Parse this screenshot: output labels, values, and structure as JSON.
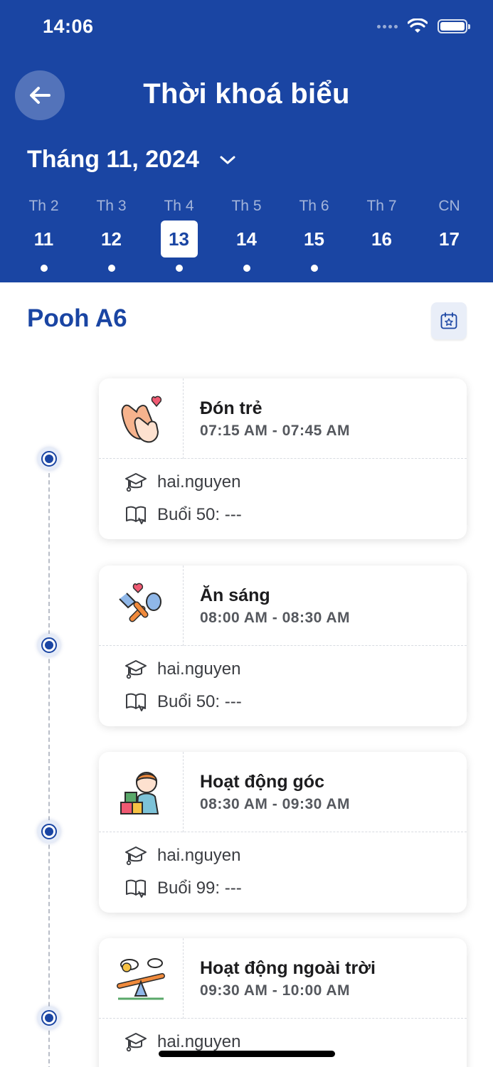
{
  "status_bar": {
    "time": "14:06"
  },
  "header": {
    "title": "Thời khoá biểu",
    "month_label": "Tháng 11, 2024"
  },
  "week": [
    {
      "name": "Th 2",
      "num": "11",
      "selected": false,
      "has_event": true
    },
    {
      "name": "Th 3",
      "num": "12",
      "selected": false,
      "has_event": true
    },
    {
      "name": "Th 4",
      "num": "13",
      "selected": true,
      "has_event": true
    },
    {
      "name": "Th 5",
      "num": "14",
      "selected": false,
      "has_event": true
    },
    {
      "name": "Th 6",
      "num": "15",
      "selected": false,
      "has_event": true
    },
    {
      "name": "Th 7",
      "num": "16",
      "selected": false,
      "has_event": false
    },
    {
      "name": "CN",
      "num": "17",
      "selected": false,
      "has_event": false
    }
  ],
  "class_name": "Pooh A6",
  "activities": [
    {
      "title": "Đón trẻ",
      "time": "07:15 AM - 07:45 AM",
      "teacher": "hai.nguyen",
      "session": "Buổi 50: ---",
      "icon": "clapping-hands-icon"
    },
    {
      "title": "Ăn sáng",
      "time": "08:00 AM - 08:30 AM",
      "teacher": "hai.nguyen",
      "session": "Buổi 50: ---",
      "icon": "fork-spoon-icon"
    },
    {
      "title": "Hoạt động góc",
      "time": "08:30 AM - 09:30 AM",
      "teacher": "hai.nguyen",
      "session": "Buổi 99: ---",
      "icon": "child-blocks-icon"
    },
    {
      "title": "Hoạt động ngoài trời",
      "time": "09:30 AM - 10:00 AM",
      "teacher": "hai.nguyen",
      "session": "",
      "icon": "seesaw-icon"
    }
  ],
  "colors": {
    "primary": "#1a45a3",
    "accent_pink": "#ef5a72",
    "skin": "#f6b38d",
    "orange": "#f08a3c"
  }
}
